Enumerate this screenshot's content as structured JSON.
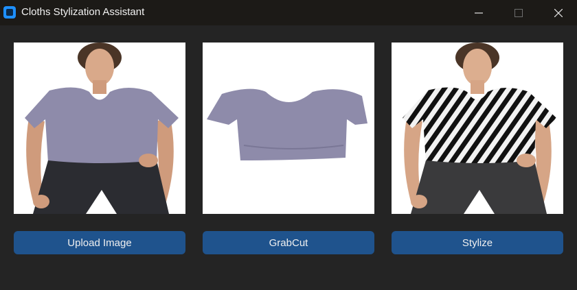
{
  "window": {
    "title": "Cloths Stylization Assistant",
    "accent_color": "#1e90ff"
  },
  "panels": [
    {
      "name": "original-photo",
      "icon": "photo-model-tshirt"
    },
    {
      "name": "grabcut-result",
      "icon": "tshirt-cutout"
    },
    {
      "name": "stylized-result",
      "icon": "photo-model-patterned-shirt"
    }
  ],
  "buttons": {
    "upload_label": "Upload Image",
    "grabcut_label": "GrabCut",
    "stylize_label": "Stylize",
    "button_color": "#1f538d"
  }
}
